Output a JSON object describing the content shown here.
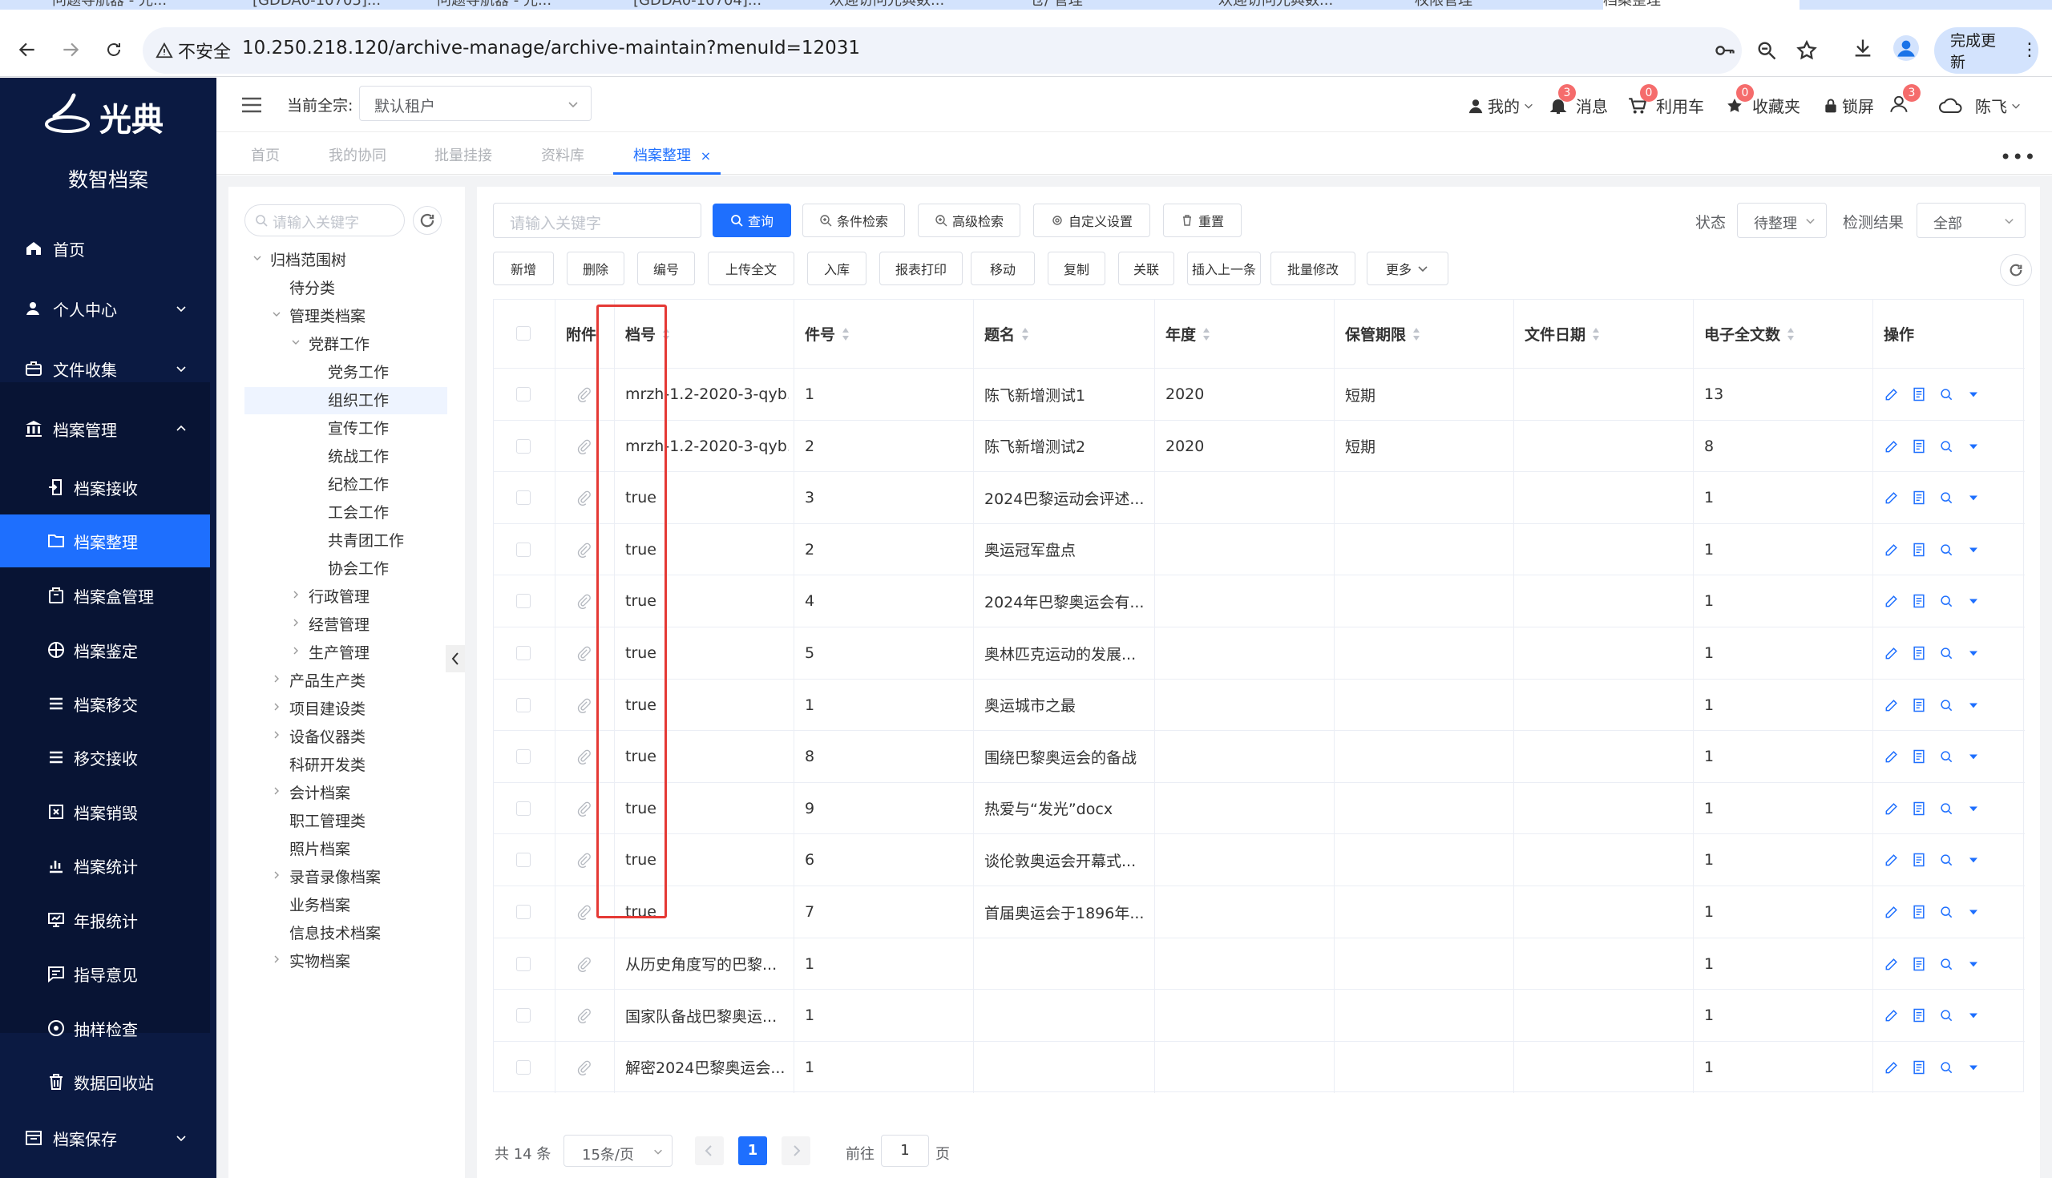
{
  "browser": {
    "tabs": [
      {
        "label": "问题导航器 - 光..."
      },
      {
        "label": "[GDDA0-10705]..."
      },
      {
        "label": "问题导航器 - 光..."
      },
      {
        "label": "[GDDA0-10704]..."
      },
      {
        "label": "欢迎访问光典数..."
      },
      {
        "label": "仓/ 管理"
      },
      {
        "label": "欢迎访问光典数..."
      },
      {
        "label": "权限管理"
      },
      {
        "label": "档案整理"
      }
    ],
    "not_secure": "不安全",
    "url": "10.250.218.120/archive-manage/archive-maintain?menuId=12031",
    "update_button": "完成更新"
  },
  "sidebar": {
    "brand": "数智档案",
    "logo_text": "光典",
    "items": [
      {
        "label": "首页",
        "icon": "home-icon"
      },
      {
        "label": "个人中心",
        "icon": "user-icon"
      },
      {
        "label": "文件收集",
        "icon": "briefcase-icon"
      },
      {
        "label": "档案管理",
        "icon": "bank-icon"
      },
      {
        "label": "档案接收",
        "icon": "receive-icon"
      },
      {
        "label": "档案整理",
        "icon": "folder-icon"
      },
      {
        "label": "档案盒管理",
        "icon": "box-icon"
      },
      {
        "label": "档案鉴定",
        "icon": "appraisal-icon"
      },
      {
        "label": "档案移交",
        "icon": "list-icon"
      },
      {
        "label": "移交接收",
        "icon": "list-icon"
      },
      {
        "label": "档案销毁",
        "icon": "destroy-icon"
      },
      {
        "label": "档案统计",
        "icon": "chart-icon"
      },
      {
        "label": "年报统计",
        "icon": "report-icon"
      },
      {
        "label": "指导意见",
        "icon": "comment-icon"
      },
      {
        "label": "抽样检查",
        "icon": "sample-icon"
      },
      {
        "label": "数据回收站",
        "icon": "trash-icon"
      },
      {
        "label": "档案保存",
        "icon": "save-icon"
      }
    ]
  },
  "header": {
    "tenant_label": "当前全宗:",
    "tenant_value": "默认租户",
    "mine": "我的",
    "messages": "消息",
    "messages_badge": "3",
    "cart": "利用车",
    "cart_badge": "0",
    "favorites": "收藏夹",
    "favorites_badge": "0",
    "lock": "锁屏",
    "user_badge": "3",
    "user_name": "陈飞"
  },
  "tags": [
    {
      "label": "首页"
    },
    {
      "label": "我的协同"
    },
    {
      "label": "批量挂接"
    },
    {
      "label": "资料库"
    },
    {
      "label": "档案整理"
    }
  ],
  "tree": {
    "search_placeholder": "请输入关键字",
    "nodes": [
      {
        "label": "归档范围树"
      },
      {
        "label": "待分类"
      },
      {
        "label": "管理类档案"
      },
      {
        "label": "党群工作"
      },
      {
        "label": "党务工作"
      },
      {
        "label": "组织工作"
      },
      {
        "label": "宣传工作"
      },
      {
        "label": "统战工作"
      },
      {
        "label": "纪检工作"
      },
      {
        "label": "工会工作"
      },
      {
        "label": "共青团工作"
      },
      {
        "label": "协会工作"
      },
      {
        "label": "行政管理"
      },
      {
        "label": "经营管理"
      },
      {
        "label": "生产管理"
      },
      {
        "label": "产品生产类"
      },
      {
        "label": "项目建设类"
      },
      {
        "label": "设备仪器类"
      },
      {
        "label": "科研开发类"
      },
      {
        "label": "会计档案"
      },
      {
        "label": "职工管理类"
      },
      {
        "label": "照片档案"
      },
      {
        "label": "录音录像档案"
      },
      {
        "label": "业务档案"
      },
      {
        "label": "信息技术档案"
      },
      {
        "label": "实物档案"
      }
    ]
  },
  "search": {
    "placeholder": "请输入关键字",
    "query": "查询",
    "condition": "条件检索",
    "advanced": "高级检索",
    "custom": "自定义设置",
    "reset": "重置",
    "status_label": "状态",
    "status_value": "待整理",
    "detect_label": "检测结果",
    "detect_value": "全部"
  },
  "toolbar": [
    "新增",
    "删除",
    "编号",
    "上传全文",
    "入库",
    "报表打印",
    "移动",
    "复制",
    "关联",
    "插入上一条",
    "批量修改",
    "更多"
  ],
  "table": {
    "columns": [
      "附件",
      "档号",
      "件号",
      "题名",
      "年度",
      "保管期限",
      "文件日期",
      "电子全文数",
      "操作"
    ],
    "rows": [
      {
        "archive_no": "mrzh-1.2-2020-3-qyb...",
        "item_no": "1",
        "title": "陈飞新增测试1",
        "year": "2020",
        "retention": "短期",
        "date": "",
        "files": "13"
      },
      {
        "archive_no": "mrzh-1.2-2020-3-qyb...",
        "item_no": "2",
        "title": "陈飞新增测试2",
        "year": "2020",
        "retention": "短期",
        "date": "",
        "files": "8"
      },
      {
        "archive_no": "true",
        "item_no": "3",
        "title": "2024巴黎运动会评述...",
        "year": "",
        "retention": "",
        "date": "",
        "files": "1"
      },
      {
        "archive_no": "true",
        "item_no": "2",
        "title": "奥运冠军盘点",
        "year": "",
        "retention": "",
        "date": "",
        "files": "1"
      },
      {
        "archive_no": "true",
        "item_no": "4",
        "title": "2024年巴黎奥运会有...",
        "year": "",
        "retention": "",
        "date": "",
        "files": "1"
      },
      {
        "archive_no": "true",
        "item_no": "5",
        "title": "奥林匹克运动的发展...",
        "year": "",
        "retention": "",
        "date": "",
        "files": "1"
      },
      {
        "archive_no": "true",
        "item_no": "1",
        "title": "奥运城市之最",
        "year": "",
        "retention": "",
        "date": "",
        "files": "1"
      },
      {
        "archive_no": "true",
        "item_no": "8",
        "title": "围绕巴黎奥运会的备战",
        "year": "",
        "retention": "",
        "date": "",
        "files": "1"
      },
      {
        "archive_no": "true",
        "item_no": "9",
        "title": "热爱与“发光”docx",
        "year": "",
        "retention": "",
        "date": "",
        "files": "1"
      },
      {
        "archive_no": "true",
        "item_no": "6",
        "title": "谈伦敦奥运会开幕式...",
        "year": "",
        "retention": "",
        "date": "",
        "files": "1"
      },
      {
        "archive_no": "true",
        "item_no": "7",
        "title": "首届奥运会于1896年...",
        "year": "",
        "retention": "",
        "date": "",
        "files": "1"
      },
      {
        "archive_no": "从历史角度写的巴黎...",
        "item_no": "1",
        "title": "",
        "year": "",
        "retention": "",
        "date": "",
        "files": "1"
      },
      {
        "archive_no": "国家队备战巴黎奥运...",
        "item_no": "1",
        "title": "",
        "year": "",
        "retention": "",
        "date": "",
        "files": "1"
      },
      {
        "archive_no": "解密2024巴黎奥运会...",
        "item_no": "1",
        "title": "",
        "year": "",
        "retention": "",
        "date": "",
        "files": "1"
      }
    ]
  },
  "pager": {
    "total": "共 14 条",
    "page_size": "15条/页",
    "current": "1",
    "goto_label": "前往",
    "goto_value": "1",
    "page_unit": "页"
  },
  "colors": {
    "accent": "#1e6ffe",
    "sidebar": "#0b1a42",
    "highlight": "#e53935"
  }
}
